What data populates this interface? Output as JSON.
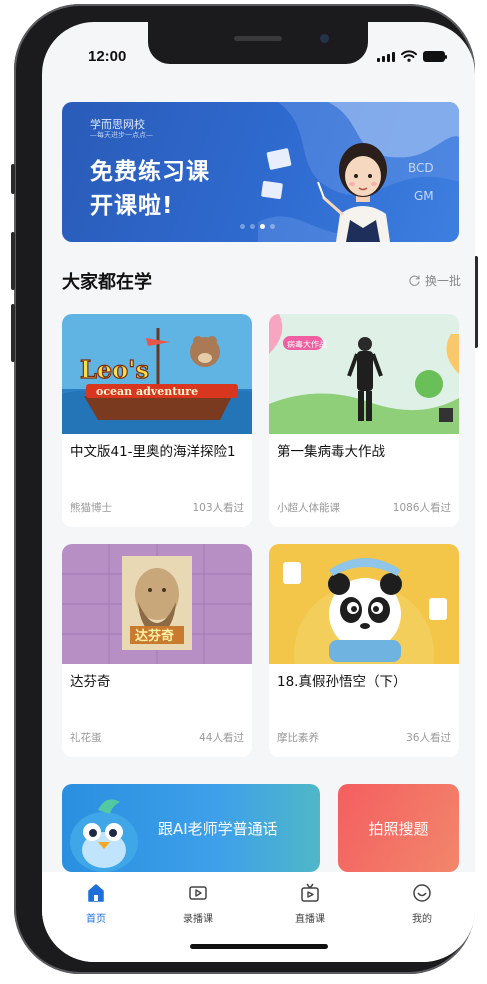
{
  "status_bar": {
    "time": "12:00"
  },
  "banner": {
    "brand": "学而思网校",
    "slogan": "—每天进步一点点—",
    "title_line1": "免费练习课",
    "title_line2": "开课啦!",
    "art_text_1": "BCD",
    "art_text_2": "GM",
    "accent_color": "#2f6bd0"
  },
  "section": {
    "title": "大家都在学",
    "refresh_label": "换一批"
  },
  "courses": [
    {
      "title": "中文版41-里奥的海洋探险1",
      "author": "熊猫博士",
      "views": "103人看过",
      "thumb_text_1": "Leo's",
      "thumb_text_2": "ocean adventure"
    },
    {
      "title": "第一集病毒大作战",
      "author": "小超人体能课",
      "views": "1086人看过",
      "thumb_text_1": "病毒大作战"
    },
    {
      "title": "达芬奇",
      "author": "礼花蛋",
      "views": "44人看过",
      "thumb_text_1": "达芬奇"
    },
    {
      "title": "18.真假孙悟空（下）",
      "author": "摩比素养",
      "views": "36人看过"
    }
  ],
  "promos": {
    "ai_label": "跟AI老师学普通话",
    "photo_label": "拍照搜题"
  },
  "tabbar": {
    "items": [
      {
        "label": "首页",
        "icon": "home-icon"
      },
      {
        "label": "录播课",
        "icon": "recorded-video-icon"
      },
      {
        "label": "直播课",
        "icon": "live-tv-icon"
      },
      {
        "label": "我的",
        "icon": "profile-face-icon"
      }
    ],
    "active_color": "#1e6fd9"
  }
}
